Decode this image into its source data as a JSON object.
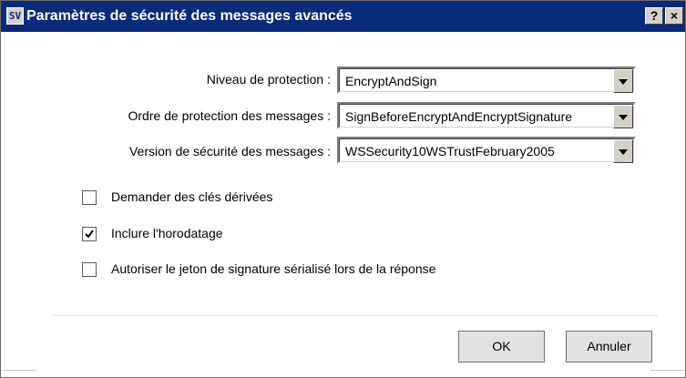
{
  "window": {
    "app_icon": "SV",
    "title": "Paramètres de sécurité des messages avancés",
    "help_label": "?",
    "close_label": "×"
  },
  "form": {
    "protection_level": {
      "label": "Niveau de protection :",
      "value": "EncryptAndSign"
    },
    "protection_order": {
      "label": "Ordre de protection des messages :",
      "value": "SignBeforeEncryptAndEncryptSignature"
    },
    "security_version": {
      "label": "Version de sécurité des messages :",
      "value": "WSSecurity10WSTrustFebruary2005"
    }
  },
  "options": [
    {
      "label": "Demander des clés dérivées",
      "checked": false
    },
    {
      "label": "Inclure l'horodatage",
      "checked": true
    },
    {
      "label": "Autoriser le jeton de signature sérialisé lors de la réponse",
      "checked": false
    }
  ],
  "buttons": {
    "ok": "OK",
    "cancel": "Annuler"
  },
  "colors": {
    "titlebar": "#0a2a7a",
    "button_face": "#d4d0c8"
  },
  "icons": [
    "app-icon",
    "help-icon",
    "close-icon",
    "dropdown-arrow-icon",
    "checkmark-icon"
  ]
}
